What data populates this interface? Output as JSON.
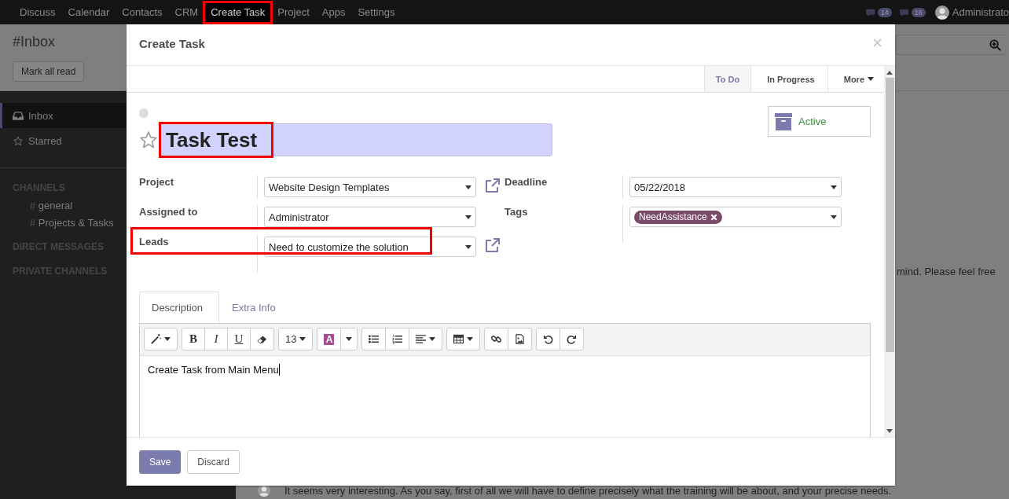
{
  "top_menu": {
    "items": [
      {
        "label": "Discuss",
        "selected": false,
        "highlighted": false
      },
      {
        "label": "Calendar",
        "selected": false,
        "highlighted": false
      },
      {
        "label": "Contacts",
        "selected": false,
        "highlighted": false
      },
      {
        "label": "CRM",
        "selected": false,
        "highlighted": false
      },
      {
        "label": "Create Task",
        "selected": true,
        "highlighted": true
      },
      {
        "label": "Project",
        "selected": false,
        "highlighted": false
      },
      {
        "label": "Apps",
        "selected": false,
        "highlighted": false
      },
      {
        "label": "Settings",
        "selected": false,
        "highlighted": false
      }
    ],
    "activity_count": "14",
    "message_count": "18",
    "user": "Administrato"
  },
  "control_panel": {
    "title": "#Inbox",
    "button": "Mark all read"
  },
  "sidebar": {
    "items": [
      {
        "label": "Inbox",
        "selected": true
      },
      {
        "label": "Starred",
        "selected": false
      }
    ],
    "sections": [
      {
        "title": "CHANNELS",
        "channels": [
          {
            "prefix": "#",
            "name": "general"
          },
          {
            "prefix": "#",
            "name": "Projects & Tasks"
          }
        ]
      },
      {
        "title": "DIRECT MESSAGES"
      },
      {
        "title": "PRIVATE CHANNELS"
      }
    ]
  },
  "messages": [
    {
      "text": "mind. Please feel free"
    },
    {
      "text": "It seems very interesting. As you say, first of all we will have to define precisely what the training will be about, and your precise needs."
    }
  ],
  "dialog": {
    "title": "Create Task",
    "stages": [
      {
        "label": "To Do",
        "selected": true
      },
      {
        "label": "In Progress",
        "selected": false
      }
    ],
    "more_label": "More",
    "starred": false,
    "name": "Task Test",
    "name_highlighted": true,
    "active_button": "Active",
    "fields_left": [
      {
        "label": "Project",
        "value": "Website Design Templates",
        "external_link": true,
        "highlighted": false
      },
      {
        "label": "Assigned to",
        "value": "Administrator",
        "external_link": false,
        "highlighted": false
      },
      {
        "label": "Leads",
        "value": "Need to customize the solution",
        "external_link": true,
        "highlighted": true
      }
    ],
    "fields_right": [
      {
        "label": "Deadline",
        "kind": "date",
        "value": "05/22/2018"
      },
      {
        "label": "Tags",
        "kind": "tags",
        "tags": [
          {
            "label": "NeedAssistance",
            "color": "#7c4a69"
          }
        ]
      }
    ],
    "tabs": [
      {
        "label": "Description",
        "selected": true
      },
      {
        "label": "Extra Info",
        "selected": false
      }
    ],
    "toolbar": [
      [
        {
          "kind": "wand"
        }
      ],
      [
        {
          "kind": "bold",
          "label": "B"
        },
        {
          "kind": "italic",
          "label": "I"
        },
        {
          "kind": "underline",
          "label": "U"
        },
        {
          "kind": "eraser"
        }
      ],
      [
        {
          "kind": "fontsize",
          "label": "13"
        }
      ],
      [
        {
          "kind": "color",
          "label": "A",
          "color": "#a34d8f"
        },
        {
          "kind": "caret"
        }
      ],
      [
        {
          "kind": "bullets"
        },
        {
          "kind": "numbers"
        },
        {
          "kind": "align"
        }
      ],
      [
        {
          "kind": "table"
        }
      ],
      [
        {
          "kind": "link"
        },
        {
          "kind": "picture"
        }
      ],
      [
        {
          "kind": "undo"
        },
        {
          "kind": "redo"
        }
      ]
    ],
    "content": "Create Task from Main Menu",
    "buttons": [
      {
        "label": "Save",
        "kind": "primary"
      },
      {
        "label": "Discard",
        "kind": "secondary"
      }
    ]
  }
}
